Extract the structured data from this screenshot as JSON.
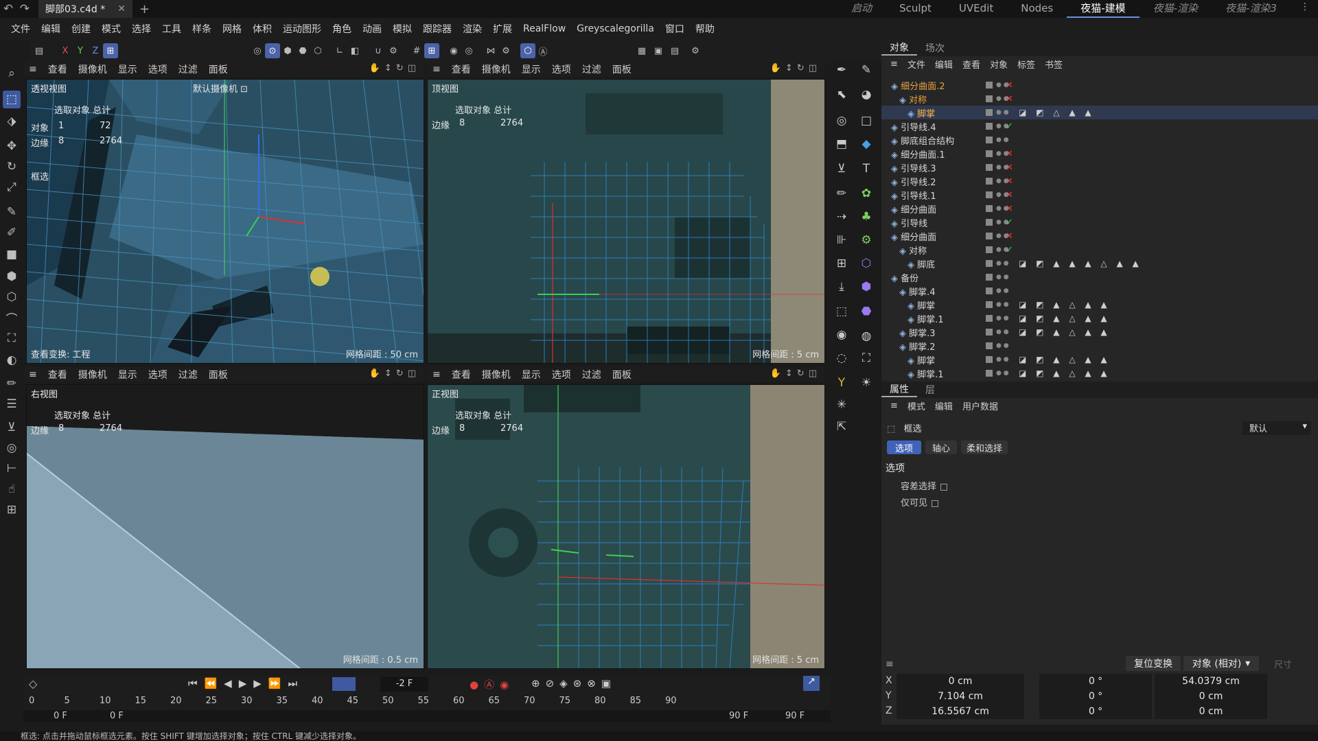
{
  "file_tab": "脚部03.c4d *",
  "layouts": [
    "启动",
    "Sculpt",
    "UVEdit",
    "Nodes",
    "夜猫-建模",
    "夜猫-渲染",
    "夜猫-渲染3"
  ],
  "active_layout": "夜猫-建模",
  "menu": [
    "文件",
    "编辑",
    "创建",
    "模式",
    "选择",
    "工具",
    "样条",
    "网格",
    "体积",
    "运动图形",
    "角色",
    "动画",
    "模拟",
    "跟踪器",
    "渲染",
    "扩展",
    "RealFlow",
    "Greyscalegorilla",
    "窗口",
    "帮助"
  ],
  "axis_toolbar": [
    "X",
    "Y",
    "Z"
  ],
  "viewport_menu": [
    "查看",
    "摄像机",
    "显示",
    "选项",
    "过滤",
    "面板"
  ],
  "viewports": {
    "tl": {
      "name": "透视视图",
      "camera": "默认摄像机 ⊡",
      "hud_header": "选取对象 总计",
      "rows": [
        [
          "对象",
          "1",
          "72"
        ],
        [
          "边缘",
          "8",
          "2764"
        ]
      ],
      "tool": "框选",
      "footer_left": "查看变换: 工程",
      "grid": "网格间距 : 50 cm"
    },
    "tr": {
      "name": "顶视图",
      "hud_header": "选取对象 总计",
      "rows": [
        [
          "边缘",
          "8",
          "2764"
        ]
      ],
      "grid": "网格间距 : 5 cm"
    },
    "bl": {
      "name": "右视图",
      "hud_header": "选取对象 总计",
      "rows": [
        [
          "边缘",
          "8",
          "2764"
        ]
      ],
      "grid": "网格间距 : 0.5 cm"
    },
    "br": {
      "name": "正视图",
      "hud_header": "选取对象 总计",
      "rows": [
        [
          "边缘",
          "8",
          "2764"
        ]
      ],
      "grid": "网格间距 : 5 cm"
    }
  },
  "obj_tabs": [
    "对象",
    "场次"
  ],
  "obj_menu": [
    "文件",
    "编辑",
    "查看",
    "对象",
    "标签",
    "书签"
  ],
  "objects": [
    {
      "name": "细分曲面.2",
      "indent": 0,
      "status": "x",
      "sel": false,
      "color": "#e8a040",
      "tags": ""
    },
    {
      "name": "对称",
      "indent": 1,
      "status": "x",
      "sel": false,
      "color": "#e8a040",
      "tags": ""
    },
    {
      "name": "脚掌",
      "indent": 2,
      "status": "",
      "sel": true,
      "color": "#ffb84a",
      "tags": "◪ ◩ △ ▲ ▲"
    },
    {
      "name": "引导线.4",
      "indent": 0,
      "status": "check",
      "sel": false,
      "color": "#d8d8d8",
      "tags": ""
    },
    {
      "name": "脚底组合结构",
      "indent": 0,
      "status": "",
      "sel": false,
      "color": "#d8d8d8",
      "tags": ""
    },
    {
      "name": "细分曲面.1",
      "indent": 0,
      "status": "x",
      "sel": false,
      "color": "#d8d8d8",
      "tags": ""
    },
    {
      "name": "引导线.3",
      "indent": 0,
      "status": "x",
      "sel": false,
      "color": "#d8d8d8",
      "tags": ""
    },
    {
      "name": "引导线.2",
      "indent": 0,
      "status": "x",
      "sel": false,
      "color": "#d8d8d8",
      "tags": ""
    },
    {
      "name": "引导线.1",
      "indent": 0,
      "status": "x",
      "sel": false,
      "color": "#d8d8d8",
      "tags": ""
    },
    {
      "name": "细分曲面",
      "indent": 0,
      "status": "x",
      "sel": false,
      "color": "#d8d8d8",
      "tags": ""
    },
    {
      "name": "引导线",
      "indent": 0,
      "status": "check",
      "sel": false,
      "color": "#d8d8d8",
      "tags": ""
    },
    {
      "name": "细分曲面",
      "indent": 0,
      "status": "x",
      "sel": false,
      "color": "#d8d8d8",
      "tags": ""
    },
    {
      "name": "对称",
      "indent": 1,
      "status": "check",
      "sel": false,
      "color": "#d8d8d8",
      "tags": ""
    },
    {
      "name": "脚底",
      "indent": 2,
      "status": "",
      "sel": false,
      "color": "#d8d8d8",
      "tags": "◪ ◩ ▲ ▲ ▲ △ ▲ ▲"
    },
    {
      "name": "备份",
      "indent": 0,
      "status": "",
      "sel": false,
      "color": "#d8d8d8",
      "tags": ""
    },
    {
      "name": "脚掌.4",
      "indent": 1,
      "status": "",
      "sel": false,
      "color": "#d8d8d8",
      "tags": ""
    },
    {
      "name": "脚掌",
      "indent": 2,
      "status": "",
      "sel": false,
      "color": "#d8d8d8",
      "tags": "◪ ◩ ▲ △ ▲ ▲"
    },
    {
      "name": "脚掌.1",
      "indent": 2,
      "status": "",
      "sel": false,
      "color": "#d8d8d8",
      "tags": "◪ ◩ ▲ △ ▲ ▲"
    },
    {
      "name": "脚掌.3",
      "indent": 1,
      "status": "",
      "sel": false,
      "color": "#d8d8d8",
      "tags": "◪ ◩ ▲ △ ▲ ▲"
    },
    {
      "name": "脚掌.2",
      "indent": 1,
      "status": "",
      "sel": false,
      "color": "#d8d8d8",
      "tags": ""
    },
    {
      "name": "脚掌",
      "indent": 2,
      "status": "",
      "sel": false,
      "color": "#d8d8d8",
      "tags": "◪ ◩ ▲ △ ▲ ▲"
    },
    {
      "name": "脚掌.1",
      "indent": 2,
      "status": "",
      "sel": false,
      "color": "#d8d8d8",
      "tags": "◪ ◩ ▲ △ ▲ ▲"
    }
  ],
  "attr_tabs": [
    "属性",
    "层"
  ],
  "attr_menu": [
    "模式",
    "编辑",
    "用户数据"
  ],
  "attr": {
    "tool": "框选",
    "preset": "默认",
    "subtabs": [
      "选项",
      "轴心",
      "柔和选择"
    ],
    "section": "选项",
    "opt1": "容差选择",
    "opt2": "仅可见"
  },
  "coords": {
    "reset": "复位变换",
    "mode": "对象 (相对)",
    "size": "尺寸",
    "rows": [
      [
        "X",
        "0 cm",
        "0 °",
        "54.0379 cm"
      ],
      [
        "Y",
        "7.104 cm",
        "0 °",
        "0 cm"
      ],
      [
        "Z",
        "16.5567 cm",
        "0 °",
        "0 cm"
      ]
    ]
  },
  "timeline": {
    "frame": "-2 F",
    "start": "0 F",
    "start2": "0 F",
    "end": "90 F",
    "end2": "90 F",
    "ticks": [
      "0",
      "5",
      "10",
      "15",
      "20",
      "25",
      "30",
      "35",
      "40",
      "45",
      "50",
      "55",
      "60",
      "65",
      "70",
      "75",
      "80",
      "85",
      "90"
    ]
  },
  "status": "框选: 点击并拖动鼠标框选元素。按住 SHIFT 键增加选择对象；按住 CTRL 键减少选择对象。"
}
